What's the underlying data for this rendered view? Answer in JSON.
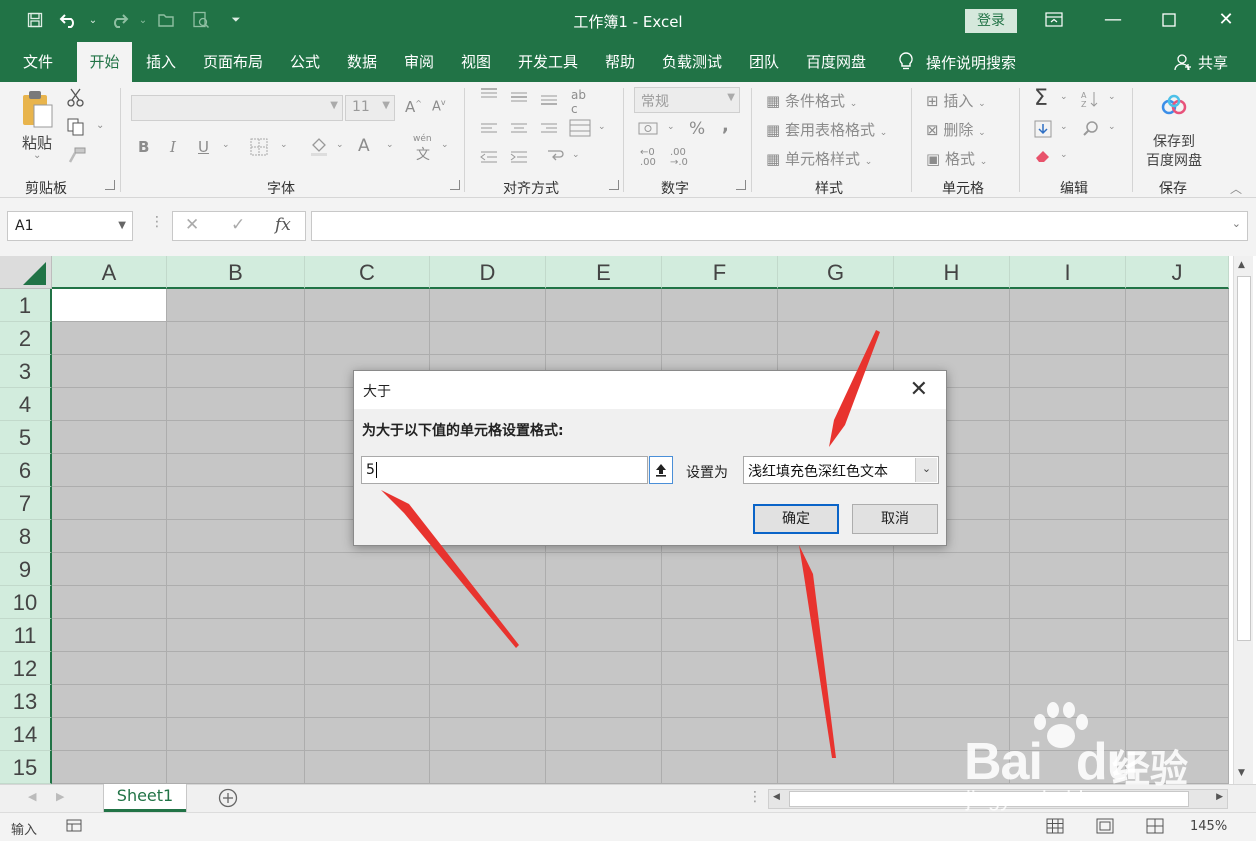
{
  "window": {
    "title": "工作簿1  -  Excel",
    "login_label": "登录",
    "controls": [
      "ribbon-display-icon",
      "minimize-icon",
      "maximize-icon",
      "close-icon"
    ]
  },
  "quick_access": [
    "save-icon",
    "undo-icon",
    "redo-icon",
    "open-icon",
    "print-preview-icon",
    "customize-icon"
  ],
  "ribbon_tabs": [
    "文件",
    "开始",
    "插入",
    "页面布局",
    "公式",
    "数据",
    "审阅",
    "视图",
    "开发工具",
    "帮助",
    "负载测试",
    "团队",
    "百度网盘"
  ],
  "active_tab": "开始",
  "tell_me": "操作说明搜索",
  "share_label": "共享",
  "ribbon": {
    "clipboard": {
      "paste_label": "粘贴",
      "group_label": "剪贴板"
    },
    "font": {
      "size_value": "11",
      "bold": "B",
      "italic": "I",
      "underline": "U",
      "font_color": "A",
      "phonetic": "wén",
      "group_label": "字体"
    },
    "alignment": {
      "group_label": "对齐方式"
    },
    "number": {
      "format_value": "常规",
      "percent": "%",
      "comma": ",",
      "group_label": "数字"
    },
    "styles": {
      "items": [
        "条件格式",
        "套用表格格式",
        "单元格样式"
      ],
      "group_label": "样式"
    },
    "cells": {
      "items": [
        "插入",
        "删除",
        "格式"
      ],
      "group_label": "单元格"
    },
    "editing": {
      "sum": "Σ",
      "group_label": "编辑"
    },
    "save": {
      "label": "保存到\n百度网盘",
      "line1": "保存到",
      "line2": "百度网盘",
      "group_label": "保存"
    }
  },
  "formula_bar": {
    "name_box": "A1",
    "fx": "fx",
    "cancel": "✕",
    "enter": "✓",
    "content": ""
  },
  "grid": {
    "columns": [
      "A",
      "B",
      "C",
      "D",
      "E",
      "F",
      "G",
      "H",
      "I",
      "J"
    ],
    "rows": [
      "1",
      "2",
      "3",
      "4",
      "5",
      "6",
      "7",
      "8",
      "9",
      "10",
      "11",
      "12",
      "13",
      "14",
      "15"
    ],
    "active_cell": "A1"
  },
  "sheets": {
    "tabs": [
      "Sheet1"
    ],
    "active": "Sheet1"
  },
  "status_bar": {
    "mode": "输入",
    "zoom": "145%"
  },
  "dialog": {
    "title": "大于",
    "prompt": "为大于以下值的单元格设置格式:",
    "value": "5",
    "set_as_label": "设置为",
    "format_option": "浅红填充色深红色文本",
    "ok_label": "确定",
    "cancel_label": "取消"
  },
  "annotations": {
    "arrow_color": "#e8332e"
  },
  "watermark": {
    "brand": "Bai du",
    "brand_b": "Bai",
    "brand_d": "du",
    "suffix": "经验",
    "url": "jingyan.baidu.com"
  },
  "colors": {
    "excel_green": "#217346",
    "header_fill": "#d2ecdd",
    "dim_overlay": "#c6c6c6",
    "ok_border": "#0a64c8"
  }
}
